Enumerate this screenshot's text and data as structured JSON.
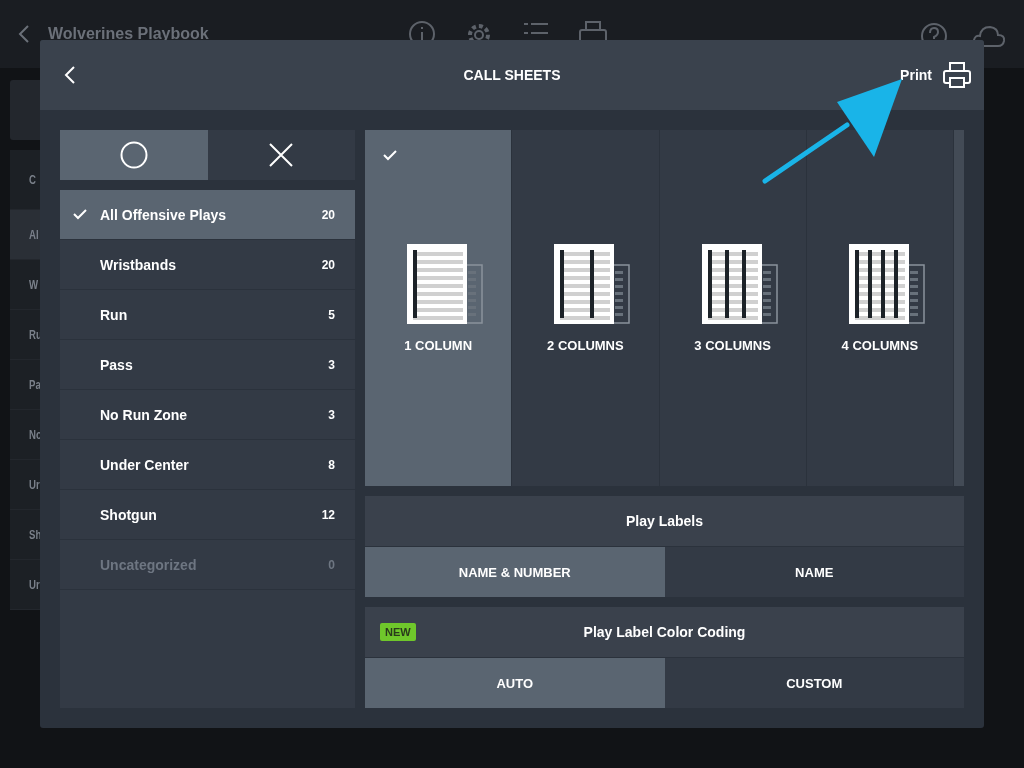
{
  "background": {
    "app_title": "Wolverines Playbook",
    "sidebar_items": [
      {
        "label": "C",
        "selected": false
      },
      {
        "label": "Al",
        "selected": true
      },
      {
        "label": "W",
        "selected": false
      },
      {
        "label": "Ru",
        "selected": false
      },
      {
        "label": "Pa",
        "selected": false
      },
      {
        "label": "No",
        "selected": false
      },
      {
        "label": "Ur",
        "selected": false
      },
      {
        "label": "Sh",
        "selected": false
      },
      {
        "label": "Ur",
        "selected": false
      }
    ]
  },
  "dialog": {
    "title": "CALL SHEETS",
    "print_label": "Print"
  },
  "filter_toggle": [
    {
      "kind": "circle",
      "selected": true
    },
    {
      "kind": "cross",
      "selected": false
    }
  ],
  "categories": [
    {
      "label": "All Offensive Plays",
      "count": "20",
      "selected": true,
      "disabled": false
    },
    {
      "label": "Wristbands",
      "count": "20",
      "selected": false,
      "disabled": false
    },
    {
      "label": "Run",
      "count": "5",
      "selected": false,
      "disabled": false
    },
    {
      "label": "Pass",
      "count": "3",
      "selected": false,
      "disabled": false
    },
    {
      "label": "No Run Zone",
      "count": "3",
      "selected": false,
      "disabled": false
    },
    {
      "label": "Under Center",
      "count": "8",
      "selected": false,
      "disabled": false
    },
    {
      "label": "Shotgun",
      "count": "12",
      "selected": false,
      "disabled": false
    },
    {
      "label": "Uncategorized",
      "count": "0",
      "selected": false,
      "disabled": true
    }
  ],
  "layouts": [
    {
      "label": "1 COLUMN",
      "selected": true
    },
    {
      "label": "2 COLUMNS",
      "selected": false
    },
    {
      "label": "3 COLUMNS",
      "selected": false
    },
    {
      "label": "4 COLUMNS",
      "selected": false
    }
  ],
  "play_labels": {
    "title": "Play Labels",
    "options": [
      {
        "label": "NAME & NUMBER",
        "selected": true
      },
      {
        "label": "NAME",
        "selected": false
      }
    ]
  },
  "color_coding": {
    "badge": "NEW",
    "title": "Play Label Color Coding",
    "options": [
      {
        "label": "AUTO",
        "selected": true
      },
      {
        "label": "CUSTOM",
        "selected": false
      }
    ]
  }
}
